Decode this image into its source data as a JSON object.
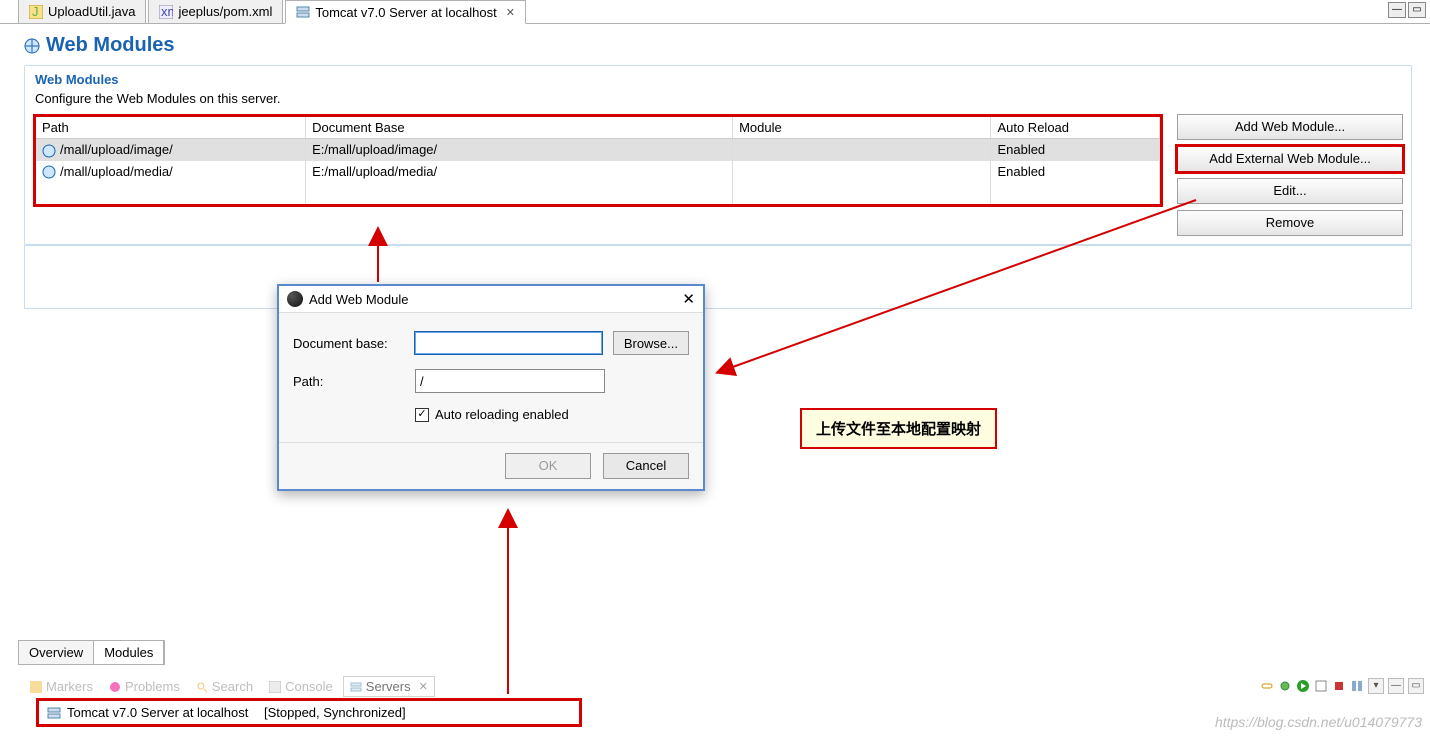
{
  "editor_tabs": {
    "t0": "UploadUtil.java",
    "t1": "jeeplus/pom.xml",
    "t2": "Tomcat v7.0 Server at localhost"
  },
  "page": {
    "title": "Web Modules",
    "section_title": "Web Modules",
    "section_desc": "Configure the Web Modules on this server."
  },
  "table": {
    "cols": {
      "c0": "Path",
      "c1": "Document Base",
      "c2": "Module",
      "c3": "Auto Reload"
    },
    "rows": [
      {
        "path": "/mall/upload/image/",
        "docbase": "E:/mall/upload/image/",
        "module": "",
        "reload": "Enabled"
      },
      {
        "path": "/mall/upload/media/",
        "docbase": "E:/mall/upload/media/",
        "module": "",
        "reload": "Enabled"
      }
    ]
  },
  "side_buttons": {
    "add": "Add Web Module...",
    "add_ext": "Add External Web Module...",
    "edit": "Edit...",
    "remove": "Remove"
  },
  "dialog": {
    "title": "Add Web Module",
    "docbase_label": "Document base:",
    "docbase_value": "",
    "browse": "Browse...",
    "path_label": "Path:",
    "path_value": "/",
    "auto_label": "Auto reloading enabled",
    "ok": "OK",
    "cancel": "Cancel"
  },
  "callout": {
    "text": "上传文件至本地配置映射"
  },
  "bottom_tabs": {
    "overview": "Overview",
    "modules": "Modules"
  },
  "views": {
    "markers": "Markers",
    "problems": "Problems",
    "search": "Search",
    "console": "Console",
    "servers": "Servers"
  },
  "server_entry": {
    "name": "Tomcat v7.0 Server at localhost",
    "status": "[Stopped, Synchronized]"
  },
  "watermark": "https://blog.csdn.net/u014079773"
}
